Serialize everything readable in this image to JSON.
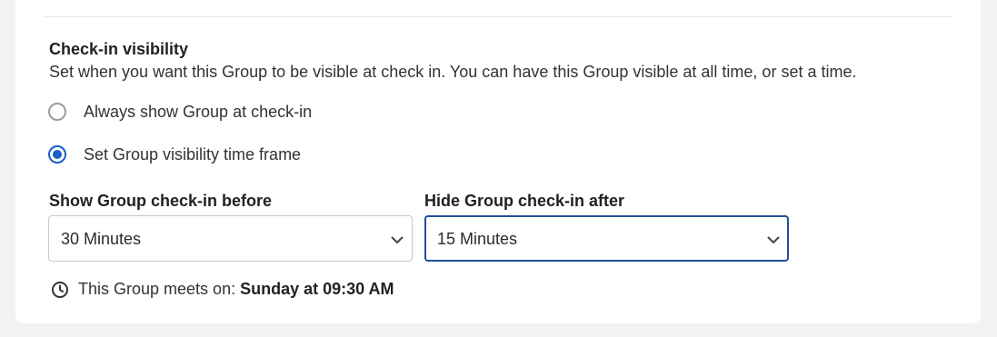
{
  "section": {
    "title": "Check-in visibility",
    "description": "Set when you want this Group to be visible at check in. You can have this Group visible at all time, or set a time."
  },
  "visibility_options": [
    {
      "label": "Always show Group at check-in",
      "checked": false
    },
    {
      "label": "Set Group visibility time frame",
      "checked": true
    }
  ],
  "show_before": {
    "label": "Show Group check-in before",
    "value": "30 Minutes"
  },
  "hide_after": {
    "label": "Hide Group check-in after",
    "value": "15 Minutes"
  },
  "meeting": {
    "prefix": "This Group meets on:",
    "schedule": "Sunday at 09:30 AM",
    "icon": "clock-icon"
  },
  "colors": {
    "accent": "#1a5fc6",
    "focus_border": "#1f4f9c",
    "background": "#f3f3f6"
  }
}
